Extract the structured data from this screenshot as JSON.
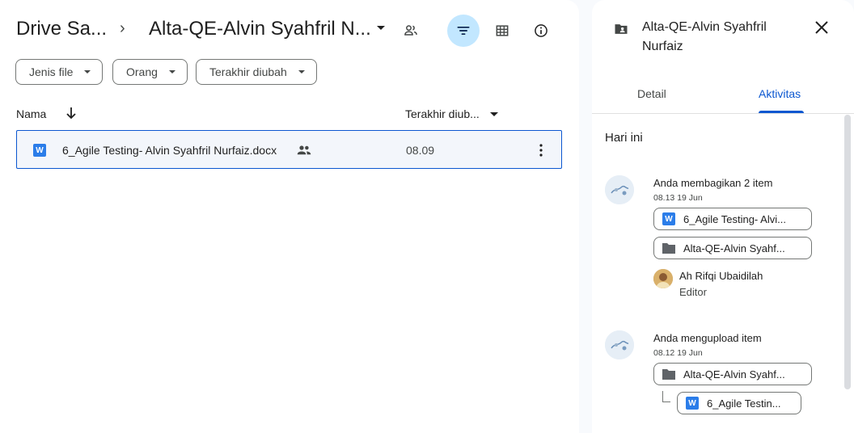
{
  "breadcrumb": {
    "root": "Drive Sa...",
    "separator": "›",
    "current": "Alta-QE-Alvin Syahfril N..."
  },
  "filters": [
    "Jenis file",
    "Orang",
    "Terakhir diubah"
  ],
  "columns": {
    "name": "Nama",
    "modified": "Terakhir diub..."
  },
  "files": [
    {
      "name": "6_Agile Testing- Alvin Syahfril Nurfaiz.docx",
      "modified": "08.09",
      "icon": "word-doc-icon",
      "shared": true
    }
  ],
  "side_panel": {
    "title": "Alta-QE-Alvin Syahfril Nurfaiz",
    "tabs": {
      "detail": "Detail",
      "activity": "Aktivitas"
    },
    "section": "Hari ini",
    "activities": [
      {
        "text": "Anda membagikan 2 item",
        "time": "08.13 19 Jun",
        "items": [
          "6_Agile Testing- Alvi...",
          "Alta-QE-Alvin Syahf..."
        ],
        "person": {
          "name": "Ah Rifqi Ubaidilah",
          "role": "Editor"
        }
      },
      {
        "text": "Anda mengupload item",
        "time": "08.12 19 Jun",
        "items": [
          "Alta-QE-Alvin Syahf...",
          "6_Agile Testin..."
        ]
      }
    ]
  },
  "colors": {
    "accent": "#0b57d0",
    "active_button": "#c2e7ff",
    "word_blue": "#2b7de9",
    "selected_row": "#f3f6fb"
  }
}
